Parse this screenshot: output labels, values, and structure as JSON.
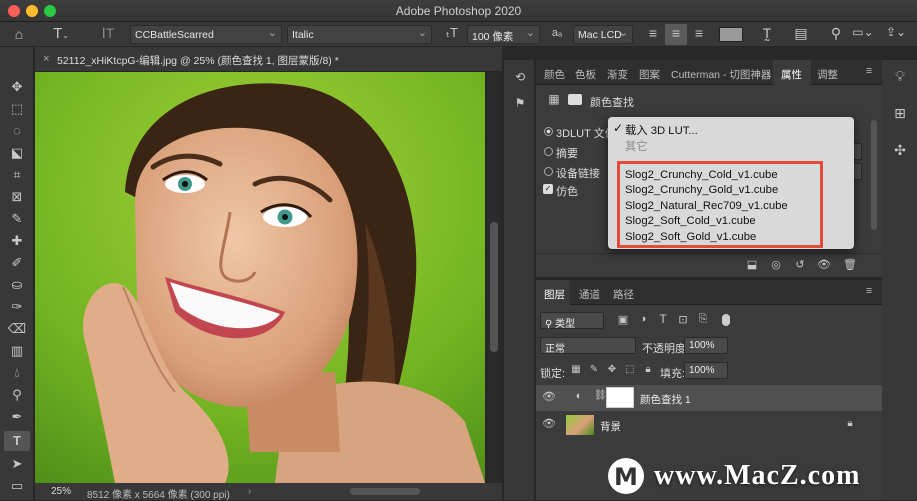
{
  "window": {
    "title": "Adobe Photoshop 2020"
  },
  "options_bar": {
    "font_family": "CCBattleScarred",
    "font_style": "Italic",
    "font_size": "100 像素",
    "aa_label": "aₐ",
    "antialias": "Mac LCD"
  },
  "document": {
    "tab_title": "52112_xHiKtcpG-编辑.jpg @ 25% (颜色查找 1, 图层蒙版/8) *",
    "zoom": "25%",
    "status": "8512 像素 x 5664 像素 (300 ppi)"
  },
  "panel_tabs": [
    "颜色",
    "色板",
    "渐变",
    "图案",
    "Cutterman - 切图神器",
    "属性",
    "调整"
  ],
  "properties": {
    "title": "颜色查找",
    "option_3dlut": "3DLUT 文件",
    "option_abstract": "摘要",
    "option_devicelink": "设备链接",
    "dither": "仿色"
  },
  "dropdown": {
    "load": "载入 3D LUT...",
    "other": "其它",
    "files": [
      "Slog2_Crunchy_Cold_v1.cube",
      "Slog2_Crunchy_Gold_v1.cube",
      "Slog2_Natural_Rec709_v1.cube",
      "Slog2_Soft_Cold_v1.cube",
      "Slog2_Soft_Gold_v1.cube"
    ]
  },
  "layers_tabs": [
    "图层",
    "通道",
    "路径"
  ],
  "layers": {
    "filter": "类型",
    "blend": "正常",
    "opacity_label": "不透明度:",
    "opacity": "100%",
    "lock_label": "锁定:",
    "fill_label": "填充:",
    "fill": "100%",
    "items": [
      {
        "name": "颜色查找 1"
      },
      {
        "name": "背景"
      }
    ]
  },
  "watermark": {
    "text": "www.MacZ.com"
  },
  "colors": {
    "highlight": "#e14b3b",
    "panel": "#3b3b3b"
  }
}
